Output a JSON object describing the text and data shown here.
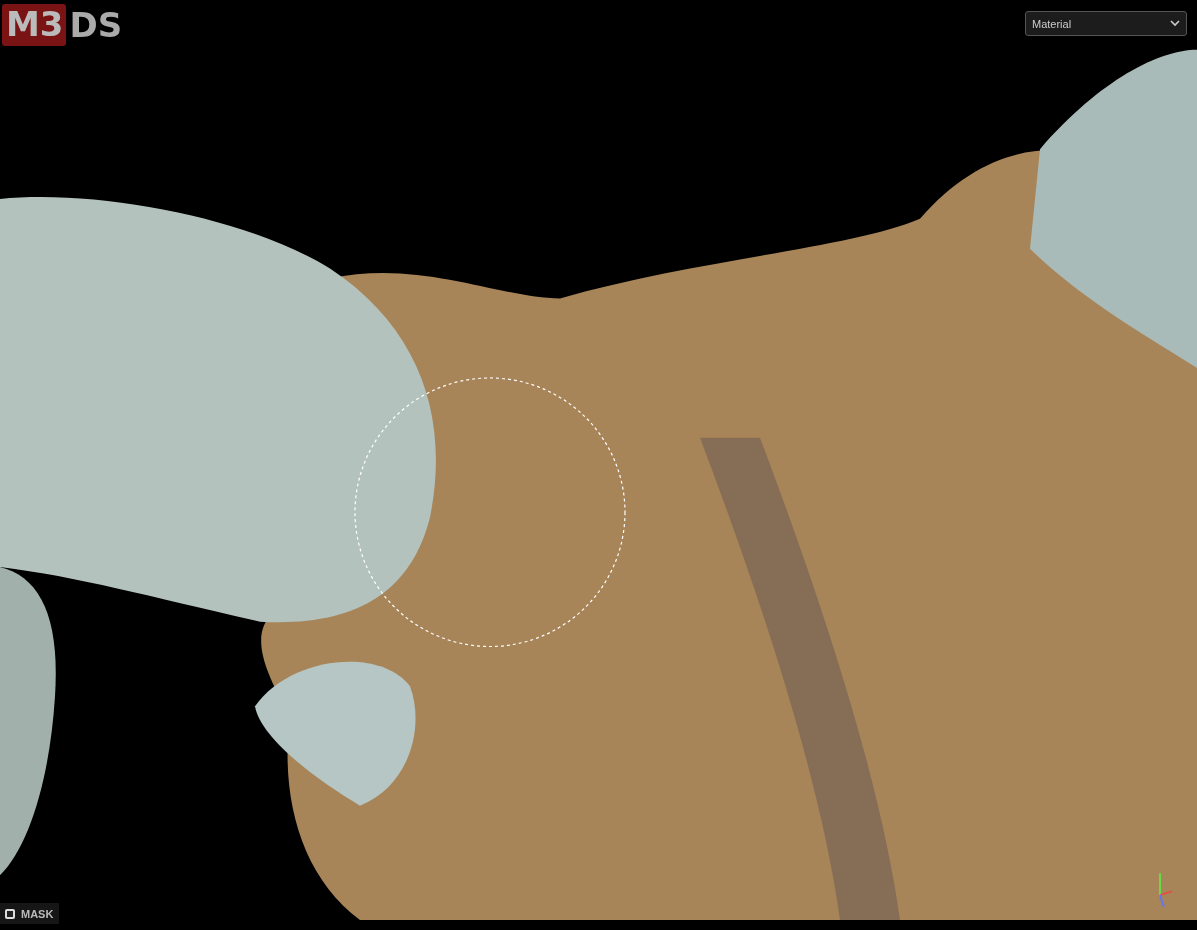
{
  "logo": {
    "boxed": "M3",
    "rest": "DS"
  },
  "view_select": {
    "value": "Material"
  },
  "mask": {
    "label": "MASK",
    "checked": false
  }
}
